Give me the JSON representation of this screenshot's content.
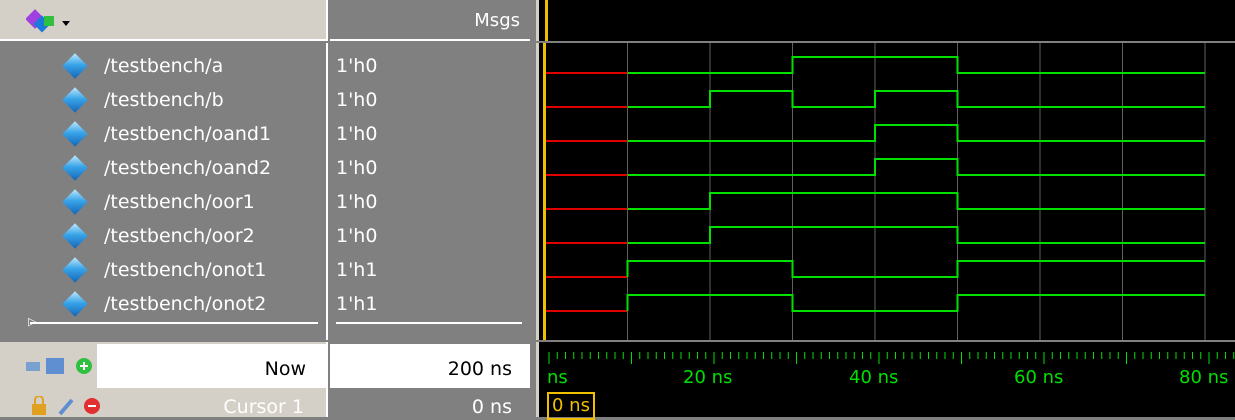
{
  "header": {
    "msgs_label": "Msgs"
  },
  "signals": [
    {
      "name": "/testbench/a",
      "value": "1'h0"
    },
    {
      "name": "/testbench/b",
      "value": "1'h0"
    },
    {
      "name": "/testbench/oand1",
      "value": "1'h0"
    },
    {
      "name": "/testbench/oand2",
      "value": "1'h0"
    },
    {
      "name": "/testbench/oor1",
      "value": "1'h0"
    },
    {
      "name": "/testbench/oor2",
      "value": "1'h0"
    },
    {
      "name": "/testbench/onot1",
      "value": "1'h1"
    },
    {
      "name": "/testbench/onot2",
      "value": "1'h1"
    }
  ],
  "status": {
    "now_label": "Now",
    "now_value": "200 ns",
    "cursor_label": "Cursor 1",
    "cursor_value": "0 ns",
    "cursor_marker": "0 ns"
  },
  "ruler": {
    "labels": [
      "ns",
      "20 ns",
      "40 ns",
      "60 ns",
      "80 ns"
    ]
  },
  "waveforms": {
    "unit_ns_per_segment": 10,
    "segments": 8,
    "a": [
      1,
      0,
      0,
      1,
      1,
      0,
      0,
      0
    ],
    "b": [
      1,
      0,
      1,
      0,
      1,
      0,
      0,
      0
    ],
    "oand1": [
      1,
      0,
      0,
      0,
      1,
      0,
      0,
      0
    ],
    "oand2": [
      1,
      0,
      0,
      0,
      1,
      0,
      0,
      0
    ],
    "oor1": [
      1,
      0,
      1,
      1,
      1,
      0,
      0,
      0
    ],
    "oor2": [
      1,
      0,
      1,
      1,
      1,
      0,
      0,
      0
    ],
    "onot1": [
      1,
      1,
      1,
      0,
      0,
      1,
      1,
      1
    ],
    "onot2": [
      1,
      1,
      1,
      0,
      0,
      1,
      1,
      1
    ]
  },
  "colors": {
    "wave": "#00e000",
    "undefined": "#e00000",
    "cursor": "#f0c000",
    "grid": "#606060"
  },
  "icons": [
    "wave-menu-icon",
    "signal-diamond-icon",
    "now-icons",
    "cursor-icons"
  ]
}
